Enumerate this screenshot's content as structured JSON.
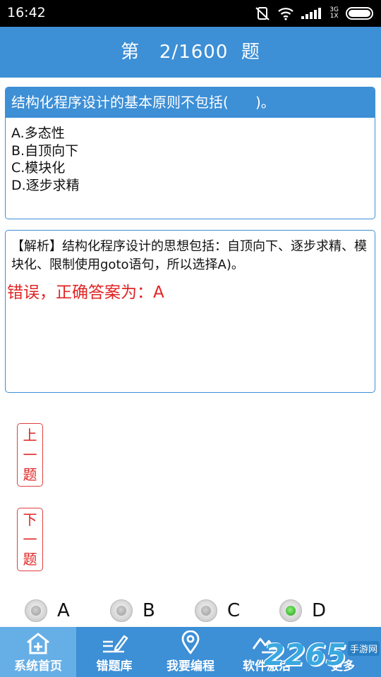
{
  "status": {
    "time": "16:42",
    "network_top": "3G",
    "network_bottom": "1X"
  },
  "header": {
    "title": "第   2/1600  题"
  },
  "question": {
    "text": "结构化程序设计的基本原则不包括(      )。",
    "options": [
      "A.多态性",
      "B.自顶向下",
      "C.模块化",
      "D.逐步求精"
    ]
  },
  "analysis": {
    "text": "【解析】结构化程序设计的思想包括：自顶向下、逐步求精、模块化、限制使用goto语句，所以选择A)。",
    "result": "错误，正确答案为：A"
  },
  "nav": {
    "prev": [
      "上",
      "一",
      "题"
    ],
    "next": [
      "下",
      "一",
      "题"
    ]
  },
  "answers": [
    {
      "label": "A",
      "checked": false
    },
    {
      "label": "B",
      "checked": false
    },
    {
      "label": "C",
      "checked": false
    },
    {
      "label": "D",
      "checked": true
    }
  ],
  "tabs": [
    {
      "label": "系统首页",
      "icon": "home-plus-icon",
      "active": true
    },
    {
      "label": "错题库",
      "icon": "pencil-lines-icon",
      "active": false
    },
    {
      "label": "我要编程",
      "icon": "location-pin-icon",
      "active": false
    },
    {
      "label": "软件激活",
      "icon": "mountain-icon",
      "active": false
    },
    {
      "label": "更多",
      "icon": "more-dots-icon",
      "active": false
    }
  ],
  "watermark": {
    "number": "2265",
    "site": "手游网"
  },
  "colors": {
    "primary": "#3d8fd6",
    "tab_active": "#66aee6",
    "error": "#e02424",
    "radio_checked": "#1e9e12"
  }
}
